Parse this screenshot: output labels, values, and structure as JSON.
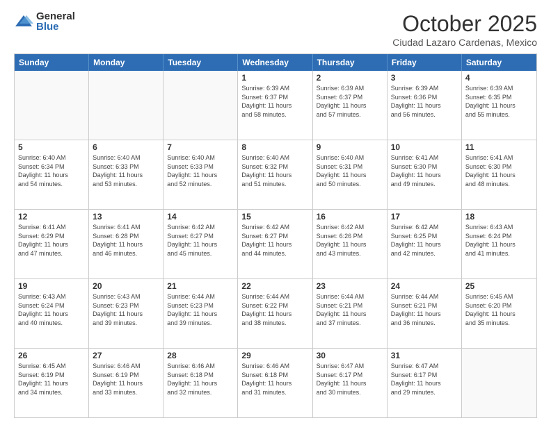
{
  "logo": {
    "general": "General",
    "blue": "Blue"
  },
  "title": "October 2025",
  "location": "Ciudad Lazaro Cardenas, Mexico",
  "weekdays": [
    "Sunday",
    "Monday",
    "Tuesday",
    "Wednesday",
    "Thursday",
    "Friday",
    "Saturday"
  ],
  "rows": [
    [
      {
        "day": "",
        "info": ""
      },
      {
        "day": "",
        "info": ""
      },
      {
        "day": "",
        "info": ""
      },
      {
        "day": "1",
        "info": "Sunrise: 6:39 AM\nSunset: 6:37 PM\nDaylight: 11 hours\nand 58 minutes."
      },
      {
        "day": "2",
        "info": "Sunrise: 6:39 AM\nSunset: 6:37 PM\nDaylight: 11 hours\nand 57 minutes."
      },
      {
        "day": "3",
        "info": "Sunrise: 6:39 AM\nSunset: 6:36 PM\nDaylight: 11 hours\nand 56 minutes."
      },
      {
        "day": "4",
        "info": "Sunrise: 6:39 AM\nSunset: 6:35 PM\nDaylight: 11 hours\nand 55 minutes."
      }
    ],
    [
      {
        "day": "5",
        "info": "Sunrise: 6:40 AM\nSunset: 6:34 PM\nDaylight: 11 hours\nand 54 minutes."
      },
      {
        "day": "6",
        "info": "Sunrise: 6:40 AM\nSunset: 6:33 PM\nDaylight: 11 hours\nand 53 minutes."
      },
      {
        "day": "7",
        "info": "Sunrise: 6:40 AM\nSunset: 6:33 PM\nDaylight: 11 hours\nand 52 minutes."
      },
      {
        "day": "8",
        "info": "Sunrise: 6:40 AM\nSunset: 6:32 PM\nDaylight: 11 hours\nand 51 minutes."
      },
      {
        "day": "9",
        "info": "Sunrise: 6:40 AM\nSunset: 6:31 PM\nDaylight: 11 hours\nand 50 minutes."
      },
      {
        "day": "10",
        "info": "Sunrise: 6:41 AM\nSunset: 6:30 PM\nDaylight: 11 hours\nand 49 minutes."
      },
      {
        "day": "11",
        "info": "Sunrise: 6:41 AM\nSunset: 6:30 PM\nDaylight: 11 hours\nand 48 minutes."
      }
    ],
    [
      {
        "day": "12",
        "info": "Sunrise: 6:41 AM\nSunset: 6:29 PM\nDaylight: 11 hours\nand 47 minutes."
      },
      {
        "day": "13",
        "info": "Sunrise: 6:41 AM\nSunset: 6:28 PM\nDaylight: 11 hours\nand 46 minutes."
      },
      {
        "day": "14",
        "info": "Sunrise: 6:42 AM\nSunset: 6:27 PM\nDaylight: 11 hours\nand 45 minutes."
      },
      {
        "day": "15",
        "info": "Sunrise: 6:42 AM\nSunset: 6:27 PM\nDaylight: 11 hours\nand 44 minutes."
      },
      {
        "day": "16",
        "info": "Sunrise: 6:42 AM\nSunset: 6:26 PM\nDaylight: 11 hours\nand 43 minutes."
      },
      {
        "day": "17",
        "info": "Sunrise: 6:42 AM\nSunset: 6:25 PM\nDaylight: 11 hours\nand 42 minutes."
      },
      {
        "day": "18",
        "info": "Sunrise: 6:43 AM\nSunset: 6:24 PM\nDaylight: 11 hours\nand 41 minutes."
      }
    ],
    [
      {
        "day": "19",
        "info": "Sunrise: 6:43 AM\nSunset: 6:24 PM\nDaylight: 11 hours\nand 40 minutes."
      },
      {
        "day": "20",
        "info": "Sunrise: 6:43 AM\nSunset: 6:23 PM\nDaylight: 11 hours\nand 39 minutes."
      },
      {
        "day": "21",
        "info": "Sunrise: 6:44 AM\nSunset: 6:23 PM\nDaylight: 11 hours\nand 39 minutes."
      },
      {
        "day": "22",
        "info": "Sunrise: 6:44 AM\nSunset: 6:22 PM\nDaylight: 11 hours\nand 38 minutes."
      },
      {
        "day": "23",
        "info": "Sunrise: 6:44 AM\nSunset: 6:21 PM\nDaylight: 11 hours\nand 37 minutes."
      },
      {
        "day": "24",
        "info": "Sunrise: 6:44 AM\nSunset: 6:21 PM\nDaylight: 11 hours\nand 36 minutes."
      },
      {
        "day": "25",
        "info": "Sunrise: 6:45 AM\nSunset: 6:20 PM\nDaylight: 11 hours\nand 35 minutes."
      }
    ],
    [
      {
        "day": "26",
        "info": "Sunrise: 6:45 AM\nSunset: 6:19 PM\nDaylight: 11 hours\nand 34 minutes."
      },
      {
        "day": "27",
        "info": "Sunrise: 6:46 AM\nSunset: 6:19 PM\nDaylight: 11 hours\nand 33 minutes."
      },
      {
        "day": "28",
        "info": "Sunrise: 6:46 AM\nSunset: 6:18 PM\nDaylight: 11 hours\nand 32 minutes."
      },
      {
        "day": "29",
        "info": "Sunrise: 6:46 AM\nSunset: 6:18 PM\nDaylight: 11 hours\nand 31 minutes."
      },
      {
        "day": "30",
        "info": "Sunrise: 6:47 AM\nSunset: 6:17 PM\nDaylight: 11 hours\nand 30 minutes."
      },
      {
        "day": "31",
        "info": "Sunrise: 6:47 AM\nSunset: 6:17 PM\nDaylight: 11 hours\nand 29 minutes."
      },
      {
        "day": "",
        "info": ""
      }
    ]
  ]
}
